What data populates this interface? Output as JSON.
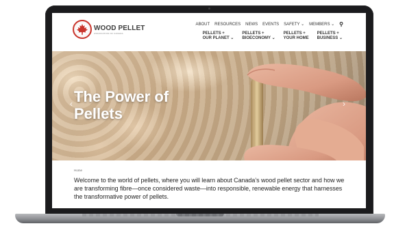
{
  "site": {
    "logo": {
      "name": "WOOD PELLET",
      "subtitle": "ASSOCIATION OF CANADA",
      "accent": "#c9342b"
    },
    "top_nav": [
      "ABOUT",
      "RESOURCES",
      "NEWS",
      "EVENTS",
      "SAFETY ⌄",
      "MEMBERS ⌄"
    ],
    "search_icon": "⚲",
    "main_nav": [
      "PELLETS +\nOUR PLANET ⌄",
      "PELLETS +\nBIOECONOMY ⌄",
      "PELLETS +\nYOUR HOME",
      "PELLETS +\nBUSINESS ⌄"
    ]
  },
  "hero": {
    "title": "The Power of Pellets",
    "prev_icon": "‹",
    "next_icon": "›"
  },
  "content": {
    "breadcrumb": "Home",
    "intro": "Welcome to the world of pellets, where you will learn about Canada’s wood pellet sector and how we are transforming fibre—once considered waste—into responsible, renewable energy that harnesses the transformative power of pellets."
  }
}
